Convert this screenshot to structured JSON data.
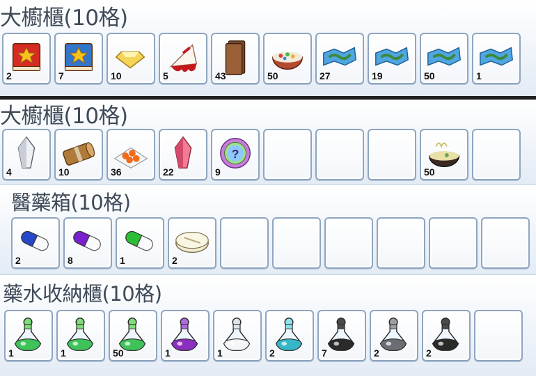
{
  "panels": [
    {
      "title": "大櫥櫃(10格)",
      "slots": [
        {
          "icon": "red-book-icon",
          "qty": "2"
        },
        {
          "icon": "blue-book-icon",
          "qty": "7"
        },
        {
          "icon": "gold-gem-icon",
          "qty": "10"
        },
        {
          "icon": "cake-slice-icon",
          "qty": "5"
        },
        {
          "icon": "chocolate-bar-icon",
          "qty": "43"
        },
        {
          "icon": "salad-bowl-icon",
          "qty": "50"
        },
        {
          "icon": "treasure-map-icon",
          "qty": "27"
        },
        {
          "icon": "treasure-map-icon",
          "qty": "19"
        },
        {
          "icon": "treasure-map-icon",
          "qty": "50"
        },
        {
          "icon": "treasure-map-icon",
          "qty": "1"
        }
      ]
    },
    {
      "title": "大櫥櫃(10格)",
      "slots": [
        {
          "icon": "white-crystal-icon",
          "qty": "4"
        },
        {
          "icon": "wooden-log-icon",
          "qty": "10"
        },
        {
          "icon": "orange-sushi-plate-icon",
          "qty": "36"
        },
        {
          "icon": "pink-crystal-icon",
          "qty": "22"
        },
        {
          "icon": "mystery-orb-icon",
          "qty": "9"
        },
        {
          "icon": "",
          "qty": ""
        },
        {
          "icon": "",
          "qty": ""
        },
        {
          "icon": "",
          "qty": ""
        },
        {
          "icon": "noodle-bowl-icon",
          "qty": "50"
        },
        {
          "icon": "",
          "qty": ""
        }
      ]
    },
    {
      "title": "醫藥箱(10格)",
      "slots": [
        {
          "icon": "blue-capsule-icon",
          "qty": "2"
        },
        {
          "icon": "purple-capsule-icon",
          "qty": "8"
        },
        {
          "icon": "green-capsule-icon",
          "qty": "1"
        },
        {
          "icon": "white-tablet-icon",
          "qty": "2"
        },
        {
          "icon": "",
          "qty": ""
        },
        {
          "icon": "",
          "qty": ""
        },
        {
          "icon": "",
          "qty": ""
        },
        {
          "icon": "",
          "qty": ""
        },
        {
          "icon": "",
          "qty": ""
        },
        {
          "icon": "",
          "qty": ""
        }
      ]
    },
    {
      "title": "藥水收納櫃(10格)",
      "slots": [
        {
          "icon": "green-potion-icon",
          "qty": "1"
        },
        {
          "icon": "green-potion-icon",
          "qty": "1"
        },
        {
          "icon": "green-potion-icon",
          "qty": "50"
        },
        {
          "icon": "purple-potion-icon",
          "qty": "1"
        },
        {
          "icon": "white-potion-icon",
          "qty": "1"
        },
        {
          "icon": "cyan-potion-icon",
          "qty": "2"
        },
        {
          "icon": "black-potion-icon",
          "qty": "7"
        },
        {
          "icon": "gray-potion-icon",
          "qty": "2"
        },
        {
          "icon": "black-potion-icon",
          "qty": "2"
        },
        {
          "icon": "",
          "qty": ""
        }
      ]
    }
  ],
  "colors": {
    "slot_border": "#8fa5bf",
    "title_text": "#3f4a58",
    "separator": "#1e1e1e"
  }
}
